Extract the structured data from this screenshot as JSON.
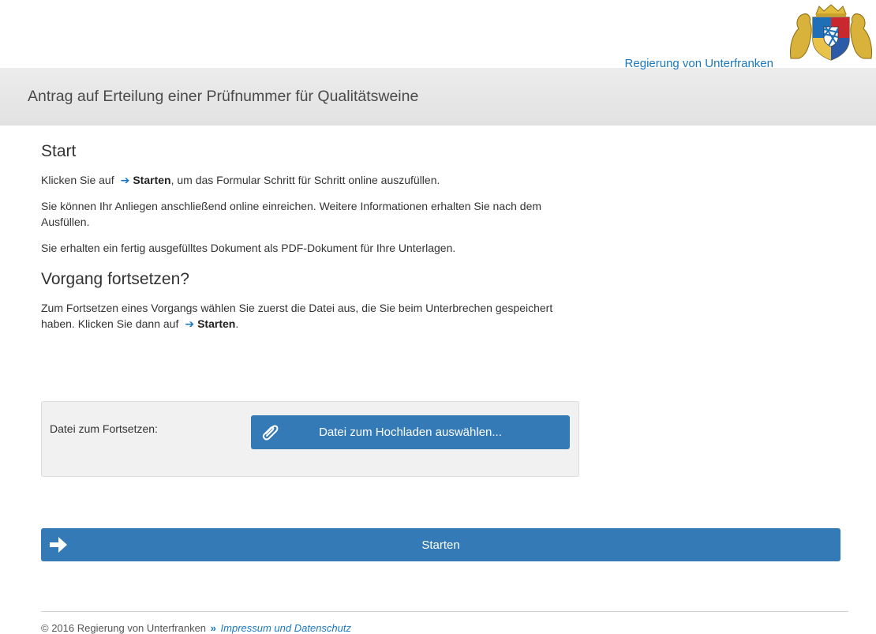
{
  "header": {
    "gov_name": "Regierung von Unterfranken",
    "logo_icon": "coat-of-arms-icon"
  },
  "title_bar": {
    "title": "Antrag auf Erteilung einer Prüfnummer für Qualitätsweine"
  },
  "start_section": {
    "heading": "Start",
    "p1_pre": "Klicken Sie auf",
    "p1_bold": "Starten",
    "p1_post": ", um das Formular Schritt für Schritt online auszufüllen.",
    "p2": "Sie können Ihr Anliegen anschließend online einreichen. Weitere Informationen erhalten Sie nach dem Ausfüllen.",
    "p3": "Sie erhalten ein fertig ausgefülltes Dokument als PDF-Dokument für Ihre Unterlagen."
  },
  "continue_section": {
    "heading": "Vorgang fortsetzen?",
    "p1_pre": "Zum Fortsetzen eines Vorgangs wählen Sie zuerst die Datei aus, die Sie beim Unterbrechen gespeichert haben. Klicken Sie dann auf",
    "p1_bold": "Starten",
    "p1_post": "."
  },
  "upload": {
    "label": "Datei zum Fortsetzen:",
    "button_label": "Datei zum Hochladen auswählen...",
    "button_icon": "paperclip-icon"
  },
  "start_button": {
    "label": "Starten",
    "icon": "arrow-right-icon"
  },
  "footer": {
    "copyright": "© 2016 Regierung von Unterfranken",
    "link": "Impressum und Datenschutz"
  },
  "colors": {
    "accent": "#337ab7",
    "link": "#1a78c2",
    "title_bar": "#e6e6e6"
  }
}
